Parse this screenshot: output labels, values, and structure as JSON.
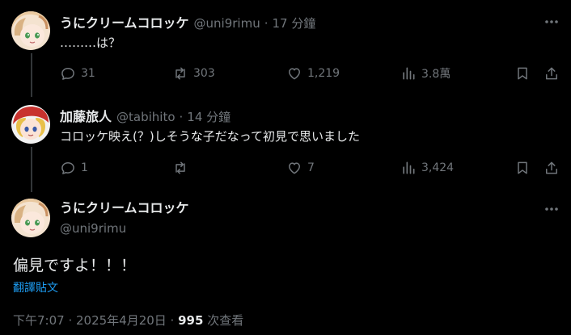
{
  "tweets": [
    {
      "name": "うにクリームコロッケ",
      "handle": "@uni9rimu",
      "dot": "·",
      "time": "17 分鐘",
      "text": "………は？",
      "replies": "31",
      "retweets": "303",
      "likes": "1,219",
      "views": "3.8萬"
    },
    {
      "name": "加藤旅人",
      "handle": "@tabihito",
      "dot": "·",
      "time": "14 分鐘",
      "text": "コロッケ映え(？)しそうな子だなって初見で思いました",
      "replies": "1",
      "retweets": "",
      "likes": "7",
      "views": "3,424"
    }
  ],
  "main_tweet": {
    "name": "うにクリームコロッケ",
    "handle": "@uni9rimu",
    "text": "偏見ですよ！！！",
    "translate_label": "翻譯貼文",
    "timestamp": "下午7:07 · 2025年4月20日 · ",
    "views_count": "995",
    "views_label": " 次查看"
  },
  "colors": {
    "background": "#000000",
    "text": "#e7e9ea",
    "muted": "#71767b",
    "accent": "#1d9bf0"
  }
}
